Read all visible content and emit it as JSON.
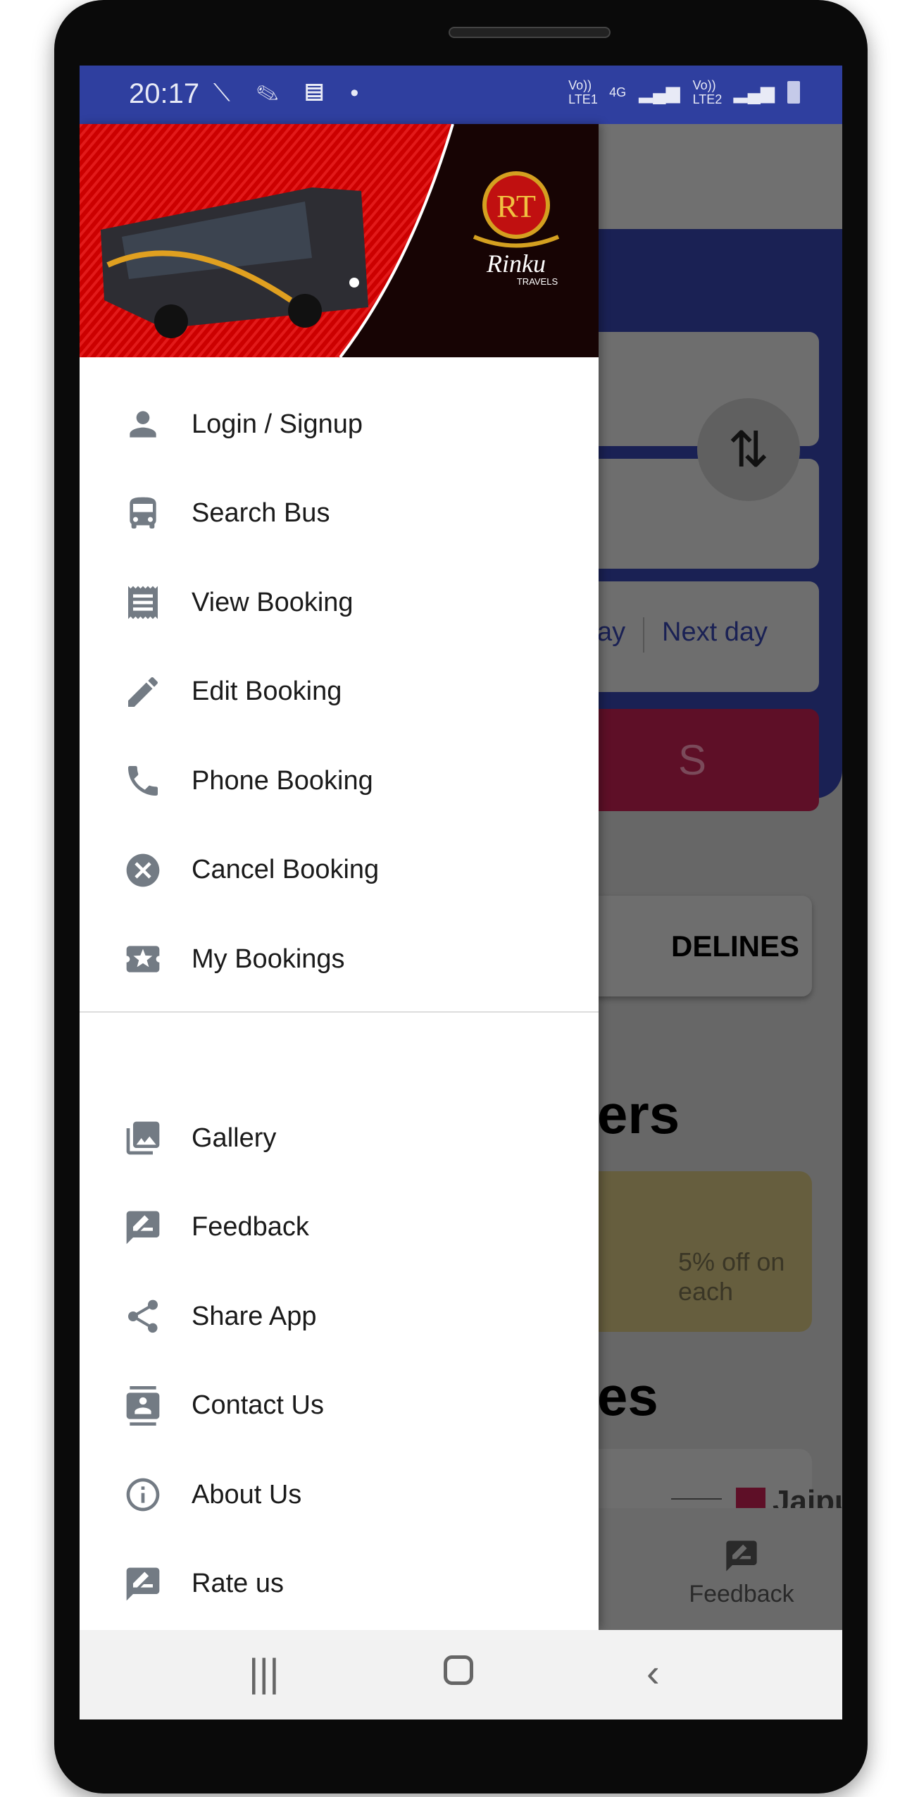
{
  "status_bar": {
    "time": "20:17",
    "sim1": "Vo)) LTE1",
    "network": "4G",
    "sim2": "Vo)) LTE2",
    "color": "#2f3f9f"
  },
  "drawer": {
    "brand": {
      "logo_letters": "RT",
      "name": "Rinku",
      "sub": "TRAVELS"
    },
    "primary_items": [
      {
        "label": "Login / Signup",
        "icon": "person-icon"
      },
      {
        "label": "Search Bus",
        "icon": "bus-icon"
      },
      {
        "label": "View Booking",
        "icon": "receipt-icon"
      },
      {
        "label": "Edit Booking",
        "icon": "pencil-icon"
      },
      {
        "label": "Phone Booking",
        "icon": "phone-icon"
      },
      {
        "label": "Cancel Booking",
        "icon": "cancel-icon"
      },
      {
        "label": "My Bookings",
        "icon": "ticket-icon"
      }
    ],
    "secondary_items": [
      {
        "label": "Gallery",
        "icon": "gallery-icon"
      },
      {
        "label": "Feedback",
        "icon": "feedback-icon"
      },
      {
        "label": "Share App",
        "icon": "share-icon"
      },
      {
        "label": "Contact Us",
        "icon": "contact-icon"
      },
      {
        "label": "About Us",
        "icon": "info-icon"
      },
      {
        "label": "Rate us",
        "icon": "rate-icon"
      }
    ]
  },
  "background": {
    "day_partial": "ay",
    "next_day": "Next day",
    "search_partial": "S",
    "guidelines_partial": "DELINES",
    "offers_partial": "ers",
    "offer_text_partial": "5% off on each",
    "routes_partial": "es",
    "route_city": "Jaipur",
    "bottom_nav_feedback": "Feedback",
    "accent": "#5e0f27",
    "primary": "#1a2154"
  }
}
